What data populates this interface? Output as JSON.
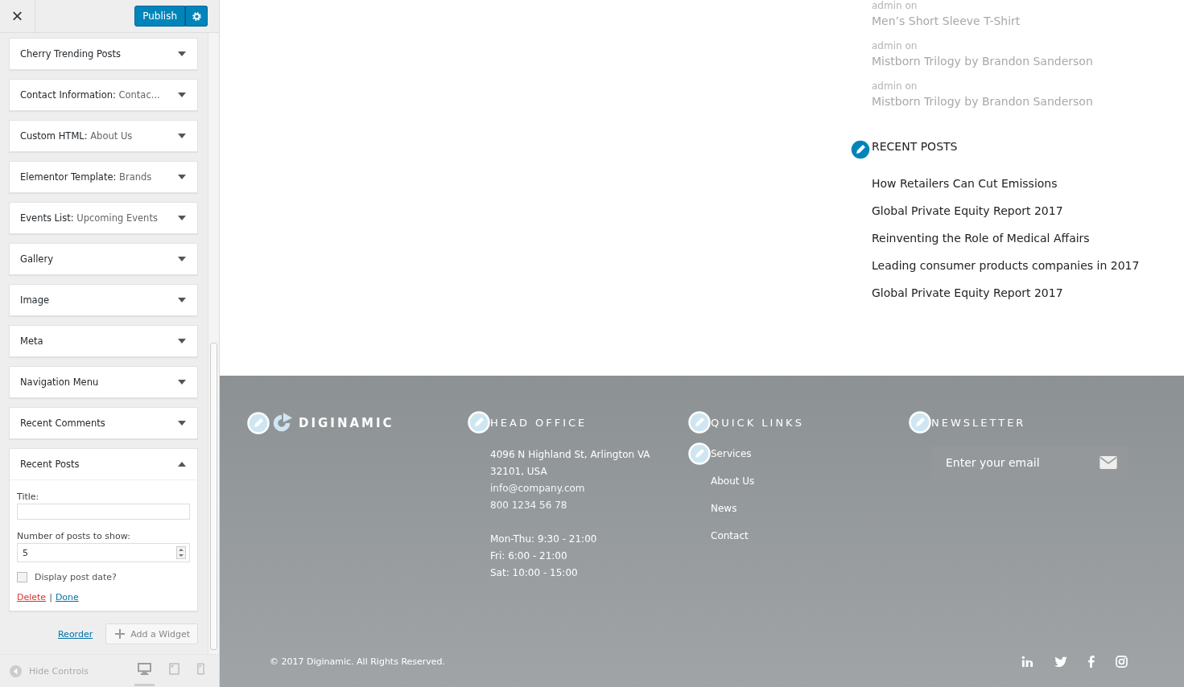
{
  "header": {
    "close": "×",
    "publish": "Publish"
  },
  "widgets": [
    {
      "title": "Cherry Trending Posts",
      "expanded": false
    },
    {
      "title": "Contact Information:",
      "subtitle": "Contac...",
      "expanded": false
    },
    {
      "title": "Custom HTML:",
      "subtitle": "About Us",
      "expanded": false
    },
    {
      "title": "Elementor Template:",
      "subtitle": "Brands",
      "expanded": false
    },
    {
      "title": "Events List:",
      "subtitle": "Upcoming Events",
      "expanded": false
    },
    {
      "title": "Gallery",
      "expanded": false
    },
    {
      "title": "Image",
      "expanded": false
    },
    {
      "title": "Meta",
      "expanded": false
    },
    {
      "title": "Navigation Menu",
      "expanded": false
    },
    {
      "title": "Recent Comments",
      "expanded": false
    },
    {
      "title": "Recent Posts",
      "expanded": true
    }
  ],
  "form": {
    "title_label": "Title:",
    "count_label": "Number of posts to show:",
    "count_value": "5",
    "checkbox_label": "Display post date?",
    "checked": false,
    "delete": "Delete",
    "separator": "|",
    "done": "Done"
  },
  "actions": {
    "reorder": "Reorder",
    "add_widget": "Add a Widget"
  },
  "bottom_bar": {
    "hide_controls": "Hide Controls",
    "devices": [
      {
        "kind": "desktop",
        "selected": true
      },
      {
        "kind": "tablet",
        "selected": false
      },
      {
        "kind": "mobile",
        "selected": false
      }
    ]
  },
  "recent_comments": [
    {
      "author": "admin on",
      "post": "Men’s Short Sleeve T-Shirt"
    },
    {
      "author": "admin on",
      "post": "Mistborn Trilogy by Brandon Sanderson"
    },
    {
      "author": "admin on",
      "post": "Mistborn Trilogy by Brandon Sanderson"
    }
  ],
  "recent_posts": {
    "heading": "RECENT POSTS",
    "items": [
      "How Retailers Can Cut Emissions",
      "Global Private Equity Report 2017",
      "Reinventing the Role of Medical Affairs",
      "Leading consumer products companies in 2017",
      "Global Private Equity Report 2017"
    ]
  },
  "footer": {
    "brand": "DIGINAMIC",
    "head_office": {
      "heading": "HEAD OFFICE",
      "address": "4096 N Highland St, Arlington VA 32101, USA",
      "email": "info@company.com",
      "phone": "800 1234 56 78",
      "hours": [
        "Mon-Thu: 9:30 - 21:00",
        "Fri: 6:00 - 21:00",
        "Sat: 10:00 - 15:00"
      ]
    },
    "quick_links": {
      "heading": "QUICK LINKS",
      "items": [
        "Services",
        "About Us",
        "News",
        "Contact"
      ]
    },
    "newsletter": {
      "heading": "NEWSLETTER",
      "placeholder": "Enter your email"
    },
    "copyright": "© 2017 Diginamic. All Rights Reserved."
  }
}
